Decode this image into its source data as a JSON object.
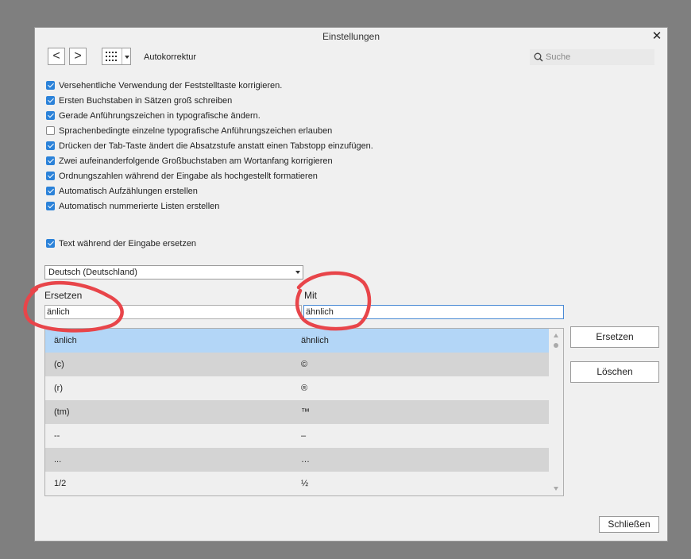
{
  "window": {
    "title": "Einstellungen",
    "close_symbol": "✕"
  },
  "toolbar": {
    "back_symbol": "<",
    "forward_symbol": ">",
    "section_title": "Autokorrektur",
    "search_placeholder": "Suche"
  },
  "options": [
    {
      "label": "Versehentliche Verwendung der Feststelltaste korrigieren.",
      "checked": true
    },
    {
      "label": "Ersten Buchstaben in Sätzen groß schreiben",
      "checked": true
    },
    {
      "label": "Gerade Anführungszeichen in typografische ändern.",
      "checked": true
    },
    {
      "label": "Sprachenbedingte einzelne typografische Anführungszeichen erlauben",
      "checked": false
    },
    {
      "label": "Drücken der Tab-Taste ändert die Absatzstufe anstatt einen Tabstopp einzufügen.",
      "checked": true
    },
    {
      "label": "Zwei aufeinanderfolgende Großbuchstaben am Wortanfang korrigieren",
      "checked": true
    },
    {
      "label": "Ordnungszahlen während der Eingabe als hochgestellt formatieren",
      "checked": true
    },
    {
      "label": "Automatisch Aufzählungen erstellen",
      "checked": true
    },
    {
      "label": "Automatisch nummerierte Listen erstellen",
      "checked": true
    }
  ],
  "replace_while_typing": {
    "label": "Text während der Eingabe ersetzen",
    "checked": true
  },
  "language": {
    "selected": "Deutsch (Deutschland)"
  },
  "replace": {
    "label": "Ersetzen",
    "value": "änlich"
  },
  "with": {
    "label": "Mit",
    "value": "ähnlich"
  },
  "table": {
    "rows": [
      {
        "replace": "änlich",
        "with": "ähnlich",
        "selected": true
      },
      {
        "replace": "(c)",
        "with": "©"
      },
      {
        "replace": "(r)",
        "with": "®"
      },
      {
        "replace": "(tm)",
        "with": "™"
      },
      {
        "replace": "--",
        "with": "–"
      },
      {
        "replace": "...",
        "with": "…"
      },
      {
        "replace": "1/2",
        "with": "½"
      }
    ]
  },
  "buttons": {
    "replace": "Ersetzen",
    "delete": "Löschen",
    "close": "Schließen"
  },
  "colors": {
    "selected_row": "#b3d6f7",
    "row_dark": "#d4d4d4",
    "row_light": "#efefef",
    "checkbox": "#2b82d9",
    "annotation": "#e8454a"
  }
}
